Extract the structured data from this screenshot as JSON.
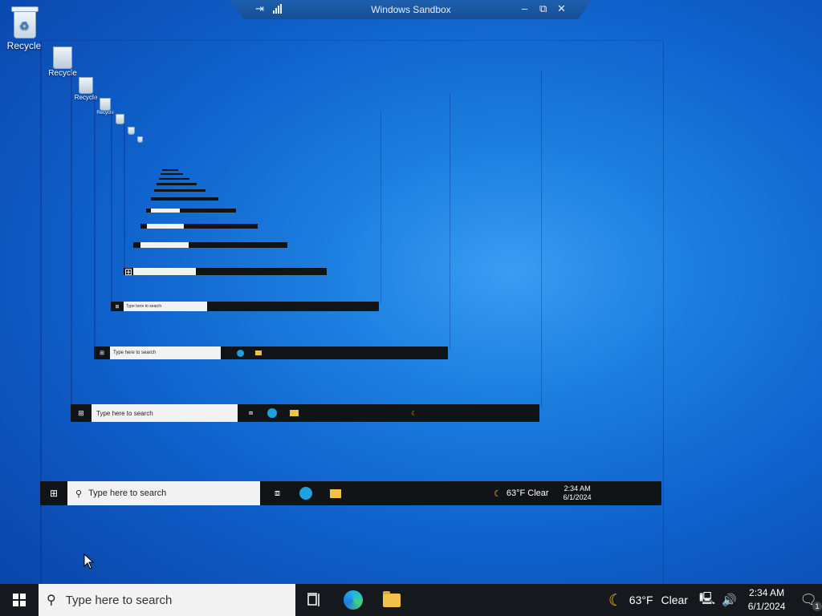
{
  "sandbox": {
    "title": "Windows Sandbox",
    "pin_icon": "pin-icon",
    "minimize": "–",
    "restore": "⧉",
    "close": "✕"
  },
  "desktop": {
    "icons": [
      {
        "label": "Recycle",
        "icon": "recycle-bin-icon"
      }
    ],
    "echo_label": "Recycle"
  },
  "taskbar": {
    "search_placeholder": "Type here to search",
    "weather_temp": "63°F",
    "weather_text": "Clear",
    "time": "2:34 AM",
    "date": "6/1/2024",
    "notification_count": "1"
  },
  "frames": {
    "search_text": "Type here to search",
    "weather": "63°F  Clear",
    "time": "2:34 AM",
    "date": "6/1/2024"
  }
}
